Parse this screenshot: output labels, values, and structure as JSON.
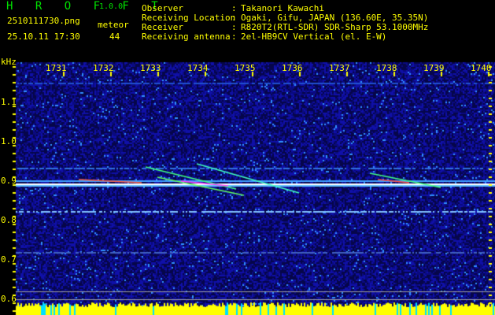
{
  "header": {
    "app_name": "H R O F F T",
    "version": "1.0.0",
    "filename": "2510111730.png",
    "datetime": "25.10.11 17:30",
    "meteor_label": "meteor",
    "meteor_count": "44"
  },
  "info": [
    {
      "label": "Observer",
      "value": "Takanori Kawachi"
    },
    {
      "label": "Receiving Location",
      "value": "Ogaki, Gifu, JAPAN (136.60E, 35.35N)"
    },
    {
      "label": "Receiver",
      "value": "R820T2(RTL-SDR) SDR-Sharp 53.1000MHz"
    },
    {
      "label": "Receiving antenna",
      "value": "2el-HB9CV Vertical (el. E-W)"
    }
  ],
  "spectrogram": {
    "y_unit": "kHz",
    "x_ticks": [
      "1731",
      "1732",
      "1733",
      "1734",
      "1735",
      "1736",
      "1737",
      "1738",
      "1739",
      "1740"
    ],
    "y_ticks": [
      "1.1",
      "1.0",
      "0.9",
      "0.8",
      "0.7",
      "0.6"
    ],
    "colors": {
      "background": "#0a0a60",
      "noise": "#2040ff",
      "axis": "#ffff00",
      "level_bar": "#ffff00",
      "level_overflow": "#00e0ff",
      "title": "#00e000"
    }
  }
}
